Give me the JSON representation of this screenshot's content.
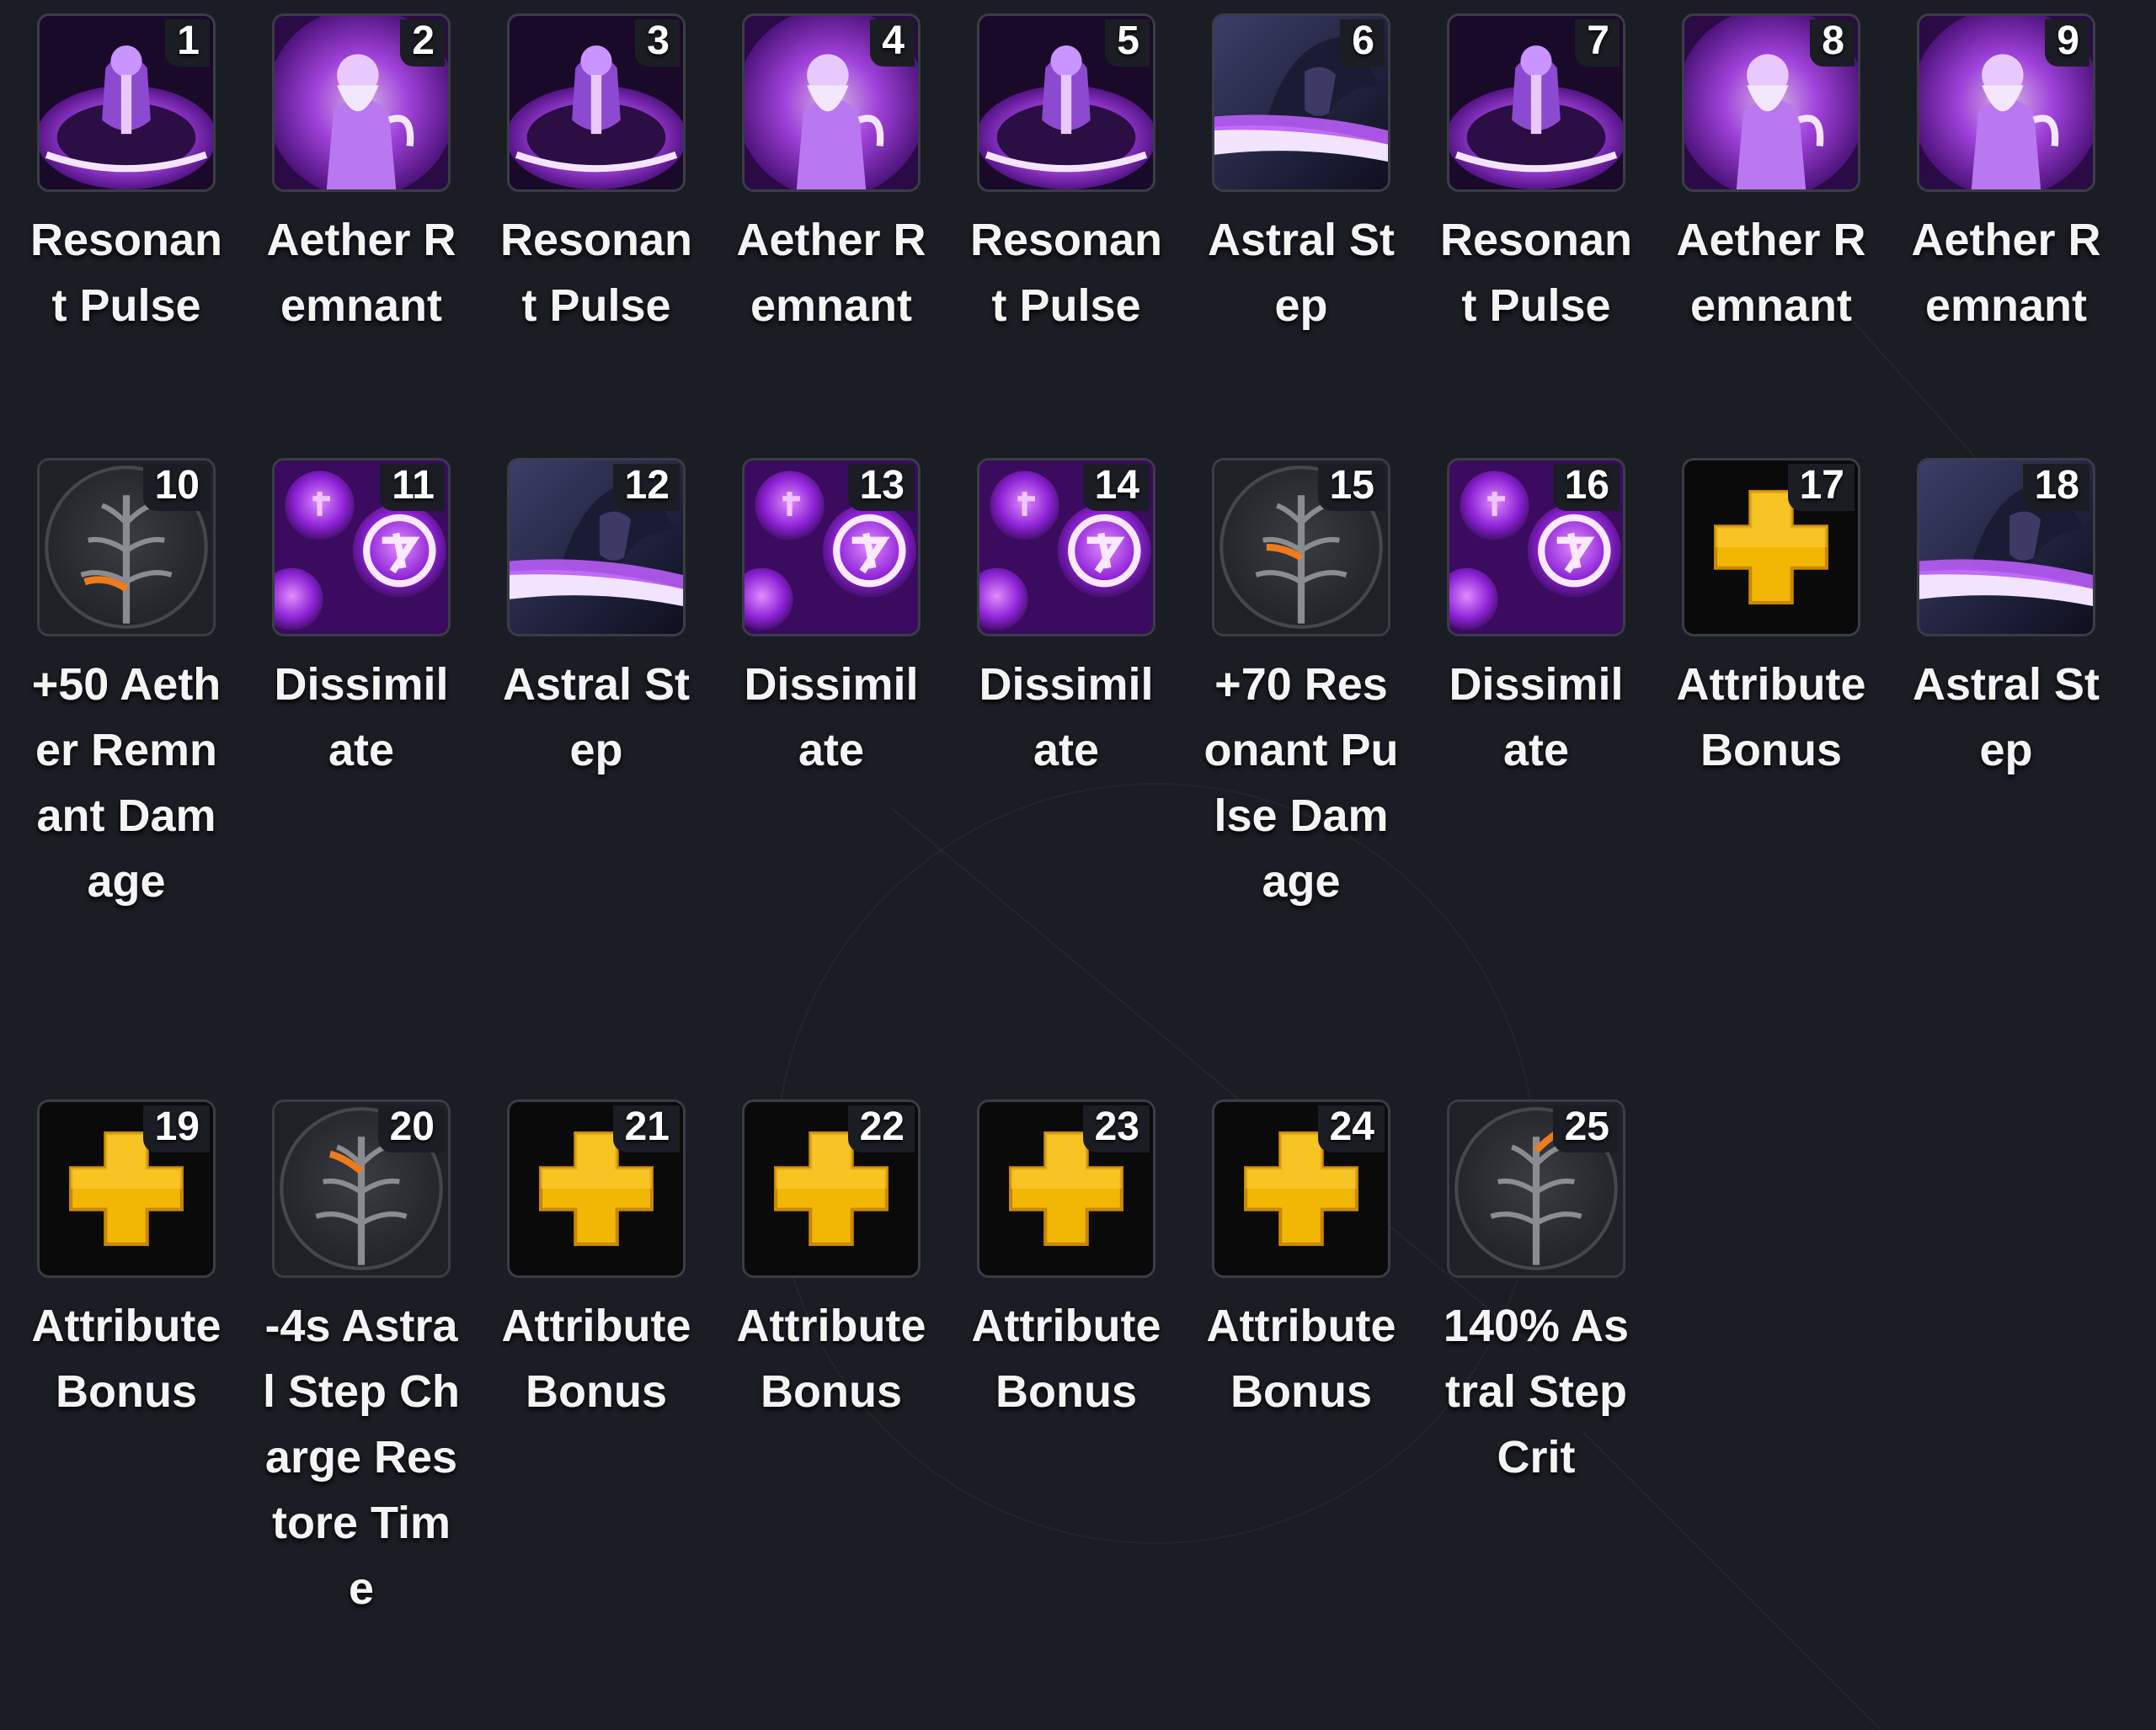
{
  "nodes": [
    {
      "number": "1",
      "label": "Resonant Pulse",
      "icon": "resonant-pulse-icon"
    },
    {
      "number": "2",
      "label": "Aether Remnant",
      "icon": "aether-remnant-icon"
    },
    {
      "number": "3",
      "label": "Resonant Pulse",
      "icon": "resonant-pulse-icon"
    },
    {
      "number": "4",
      "label": "Aether Remnant",
      "icon": "aether-remnant-icon"
    },
    {
      "number": "5",
      "label": "Resonant Pulse",
      "icon": "resonant-pulse-icon"
    },
    {
      "number": "6",
      "label": "Astral Step",
      "icon": "astral-step-icon"
    },
    {
      "number": "7",
      "label": "Resonant Pulse",
      "icon": "resonant-pulse-icon"
    },
    {
      "number": "8",
      "label": "Aether Remnant",
      "icon": "aether-remnant-icon"
    },
    {
      "number": "9",
      "label": "Aether Remnant",
      "icon": "aether-remnant-icon"
    },
    {
      "number": "10",
      "label": "+50 Aether Remnant Damage",
      "icon": "talent-branch-icon"
    },
    {
      "number": "11",
      "label": "Dissimilate",
      "icon": "dissimilate-icon"
    },
    {
      "number": "12",
      "label": "Astral Step",
      "icon": "astral-step-icon"
    },
    {
      "number": "13",
      "label": "Dissimilate",
      "icon": "dissimilate-icon"
    },
    {
      "number": "14",
      "label": "Dissimilate",
      "icon": "dissimilate-icon"
    },
    {
      "number": "15",
      "label": "+70 Resonant Pulse Damage",
      "icon": "talent-branch-icon"
    },
    {
      "number": "16",
      "label": "Dissimilate",
      "icon": "dissimilate-icon"
    },
    {
      "number": "17",
      "label": "Attribute Bonus",
      "icon": "attribute-bonus-icon"
    },
    {
      "number": "18",
      "label": "Astral Step",
      "icon": "astral-step-icon"
    },
    {
      "number": "19",
      "label": "Attribute Bonus",
      "icon": "attribute-bonus-icon"
    },
    {
      "number": "20",
      "label": "-4s Astral Step Charge Restore Time",
      "icon": "talent-branch-icon"
    },
    {
      "number": "21",
      "label": "Attribute Bonus",
      "icon": "attribute-bonus-icon"
    },
    {
      "number": "22",
      "label": "Attribute Bonus",
      "icon": "attribute-bonus-icon"
    },
    {
      "number": "23",
      "label": "Attribute Bonus",
      "icon": "attribute-bonus-icon"
    },
    {
      "number": "24",
      "label": "Attribute Bonus",
      "icon": "attribute-bonus-icon"
    },
    {
      "number": "25",
      "label": "140% Astral Step Crit",
      "icon": "talent-branch-icon"
    }
  ],
  "colors": {
    "background": "#1b1d24",
    "ability_purple": "#a63cf0",
    "attribute_gold": "#f2b705",
    "talent_orange": "#f07b1a",
    "text": "#f4f4f4"
  }
}
